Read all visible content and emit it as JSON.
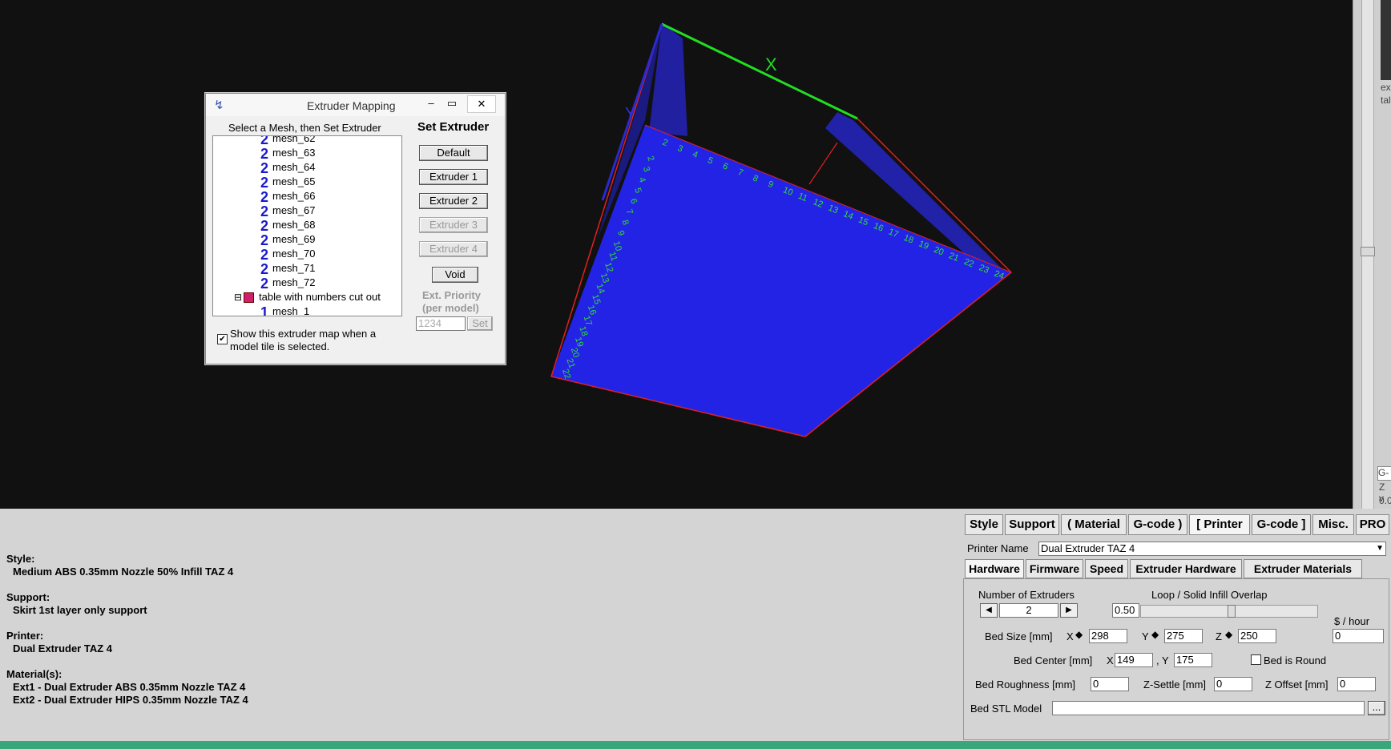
{
  "dialog": {
    "title": "Extruder Mapping",
    "tree_header": "Select a Mesh, then Set Extruder",
    "set_header": "Set Extruder",
    "rows": [
      {
        "glyph": "2",
        "label": "mesh_62"
      },
      {
        "glyph": "2",
        "label": "mesh_63"
      },
      {
        "glyph": "2",
        "label": "mesh_64"
      },
      {
        "glyph": "2",
        "label": "mesh_65"
      },
      {
        "glyph": "2",
        "label": "mesh_66"
      },
      {
        "glyph": "2",
        "label": "mesh_67"
      },
      {
        "glyph": "2",
        "label": "mesh_68"
      },
      {
        "glyph": "2",
        "label": "mesh_69"
      },
      {
        "glyph": "2",
        "label": "mesh_70"
      },
      {
        "glyph": "2",
        "label": "mesh_71"
      },
      {
        "glyph": "2",
        "label": "mesh_72"
      },
      {
        "glyph": "",
        "label": "table with numbers cut out"
      },
      {
        "glyph": "1",
        "label": "mesh_1"
      }
    ],
    "buttons": {
      "default": "Default",
      "ext1": "Extruder 1",
      "ext2": "Extruder 2",
      "ext3": "Extruder 3",
      "ext4": "Extruder 4",
      "void": "Void"
    },
    "priority_label_1": "Ext. Priority",
    "priority_label_2": "(per model)",
    "priority_value": "1234",
    "set_label": "Set",
    "show_map_label_1": "Show this extruder map when a",
    "show_map_label_2": "model tile is selected.",
    "show_map_checked": true
  },
  "viewport": {
    "x_axis_label": "X",
    "y_axis_label": "Y",
    "bed_numbers_top": [
      "2",
      "3",
      "4",
      "5",
      "6",
      "7",
      "8",
      "9",
      "10",
      "11",
      "12",
      "13",
      "14",
      "15",
      "16",
      "17",
      "18",
      "19",
      "20",
      "21",
      "22",
      "23",
      "24"
    ],
    "bed_numbers_left": [
      "2",
      "3",
      "4",
      "5",
      "6",
      "7",
      "8",
      "9",
      "10",
      "11",
      "12",
      "13",
      "14",
      "15",
      "16",
      "17",
      "18",
      "19",
      "20",
      "21",
      "22"
    ],
    "colors": {
      "bed": "#2323e6",
      "x_axis": "#22dd22",
      "y_axis": "#2a2ad0",
      "edge": "#e02020",
      "numbers": "#33dd33"
    }
  },
  "right_strip": {
    "text1": "ex",
    "text2": "tal",
    "text3": "G-",
    "text4": "Z v",
    "text5": "0.0"
  },
  "info": {
    "style_label": "Style:",
    "style_value": "Medium ABS 0.35mm Nozzle 50% Infill TAZ 4",
    "support_label": "Support:",
    "support_value": "Skirt 1st layer only support",
    "printer_label": "Printer:",
    "printer_value": "Dual Extruder TAZ 4",
    "materials_label": "Material(s):",
    "material1": "Ext1 - Dual Extruder ABS 0.35mm Nozzle TAZ 4",
    "material2": "Ext2 - Dual Extruder HIPS 0.35mm Nozzle TAZ 4"
  },
  "settings": {
    "tabs": [
      "Style",
      "Support",
      "( Material",
      "G-code )",
      "[ Printer",
      "G-code ]",
      "Misc.",
      "PRO"
    ],
    "printer_name_label": "Printer Name",
    "printer_name_value": "Dual Extruder TAZ 4",
    "subtabs": [
      "Hardware",
      "Firmware",
      "Speed",
      "Extruder Hardware",
      "Extruder Materials"
    ],
    "num_extruders_label": "Number of Extruders",
    "num_extruders_value": "2",
    "overlap_label": "Loop / Solid Infill Overlap",
    "overlap_value": "0.50",
    "dollar_label": "$ / hour",
    "dollar_value": "0",
    "bed_size_label": "Bed Size [mm]",
    "bed_x_label": "X",
    "bed_x": "298",
    "bed_y_label": "Y",
    "bed_y": "275",
    "bed_z_label": "Z",
    "bed_z": "250",
    "bed_center_label": "Bed Center [mm]",
    "center_x_label": "X",
    "center_x": "149",
    "center_y_label": ", Y",
    "center_y": "175",
    "bed_round_label": "Bed is Round",
    "roughness_label": "Bed Roughness [mm]",
    "roughness_value": "0",
    "zsettle_label": "Z-Settle [mm]",
    "zsettle_value": "0",
    "zoffset_label": "Z Offset [mm]",
    "zoffset_value": "0",
    "stl_label": "Bed STL Model",
    "stl_value": "",
    "browse_label": "..."
  }
}
